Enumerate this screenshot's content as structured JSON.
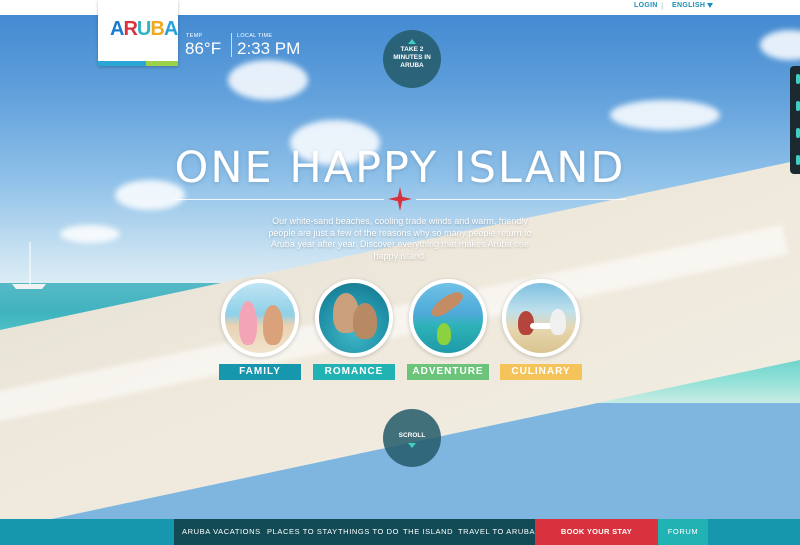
{
  "topbar": {
    "login_label": "LOGIN",
    "separator": "|",
    "language_label": "ENGLISH"
  },
  "logo": {
    "letters": [
      "A",
      "R",
      "U",
      "B",
      "A"
    ],
    "colors": [
      "#1a7bd4",
      "#d8323f",
      "#2fb2c2",
      "#f2a81d",
      "#27a2db"
    ]
  },
  "weather": {
    "temp_label": "TEMP",
    "temp_value": "86°F",
    "time_label": "LOCAL TIME",
    "time_value": "2:33 PM"
  },
  "video_button": {
    "label_line1": "TAKE 2",
    "label_line2": "MINUTES IN",
    "label_line3": "ARUBA"
  },
  "hero": {
    "headline": "ONE HAPPY ISLAND",
    "intro": "Our white-sand beaches, cooling trade winds and warm, friendly people are just a few of the reasons why so many people return to Aruba year after year. Discover everything that makes Aruba one happy island.",
    "star_color": "#d8323f"
  },
  "categories": [
    {
      "label": "FAMILY",
      "color": "#1797ae"
    },
    {
      "label": "ROMANCE",
      "color": "#21b3b3"
    },
    {
      "label": "ADVENTURE",
      "color": "#6cc37a"
    },
    {
      "label": "CULINARY",
      "color": "#f4c35a"
    }
  ],
  "scroll_button": {
    "label": "SCROLL"
  },
  "bottom_nav": {
    "items": [
      "ARUBA VACATIONS",
      "PLACES TO STAY",
      "THINGS TO DO",
      "THE ISLAND",
      "TRAVEL TO ARUBA"
    ],
    "book_label": "BOOK YOUR STAY",
    "forum_label": "FORUM"
  }
}
